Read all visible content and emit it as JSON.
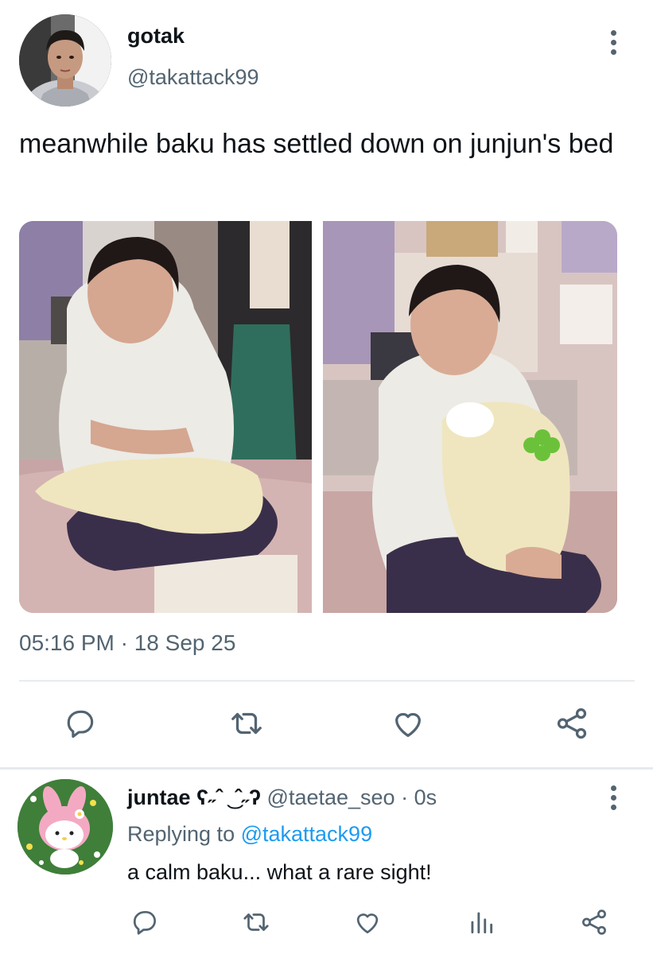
{
  "tweet": {
    "author": {
      "display_name": "gotak",
      "handle": "@takattack99",
      "avatar_icon": "user-photo-avatar"
    },
    "text": "meanwhile baku has settled down on junjun's bed",
    "media": [
      {
        "icon": "photo-boy-with-seal-plush"
      },
      {
        "icon": "photo-boy-with-plush-and-clover"
      }
    ],
    "timestamp": "05:16 PM · 18 Sep 25",
    "actions": [
      "reply-icon",
      "retweet-icon",
      "like-icon",
      "share-icon"
    ],
    "more_icon": "more-vertical-icon"
  },
  "reply": {
    "author": {
      "display_name": "juntae ʕ˶ˆ ͜ ˆ˶ʔ",
      "handle": "@taetae_seo",
      "separator": " · ",
      "time": "0s",
      "avatar_icon": "my-melody-avatar"
    },
    "replying_prefix": "Replying to ",
    "replying_to": "@takattack99",
    "text": "a calm baku... what a rare sight!",
    "actions": [
      "reply-icon",
      "retweet-icon",
      "like-icon",
      "analytics-icon",
      "share-icon"
    ],
    "more_icon": "more-vertical-icon"
  },
  "colors": {
    "text": "#0f1419",
    "secondary": "#536471",
    "link": "#1d9bf0",
    "divider": "#d9dde1"
  }
}
